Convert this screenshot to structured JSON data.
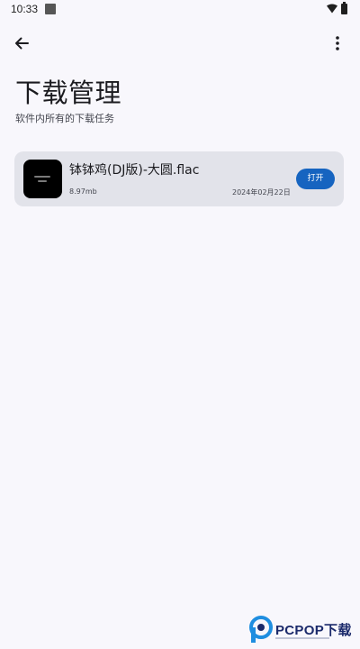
{
  "status_bar": {
    "time": "10:33",
    "notification_icon": "square-icon",
    "wifi_icon": "wifi-icon",
    "battery_icon": "battery-icon"
  },
  "top_bar": {
    "back_icon": "arrow-left-icon",
    "more_icon": "more-vertical-icon"
  },
  "header": {
    "title": "下载管理",
    "subtitle": "软件内所有的下载任务"
  },
  "downloads": [
    {
      "file_name": "钵钵鸡(DJ版)-大圆.flac",
      "size": "8.97mb",
      "date": "2024年02月22日",
      "action_label": "打开"
    }
  ],
  "watermark": {
    "text": "PCPOP下载"
  },
  "colors": {
    "background": "#f8f7fc",
    "card": "#e2e3ea",
    "accent": "#1664c0",
    "watermark": "#1b2a6b"
  }
}
